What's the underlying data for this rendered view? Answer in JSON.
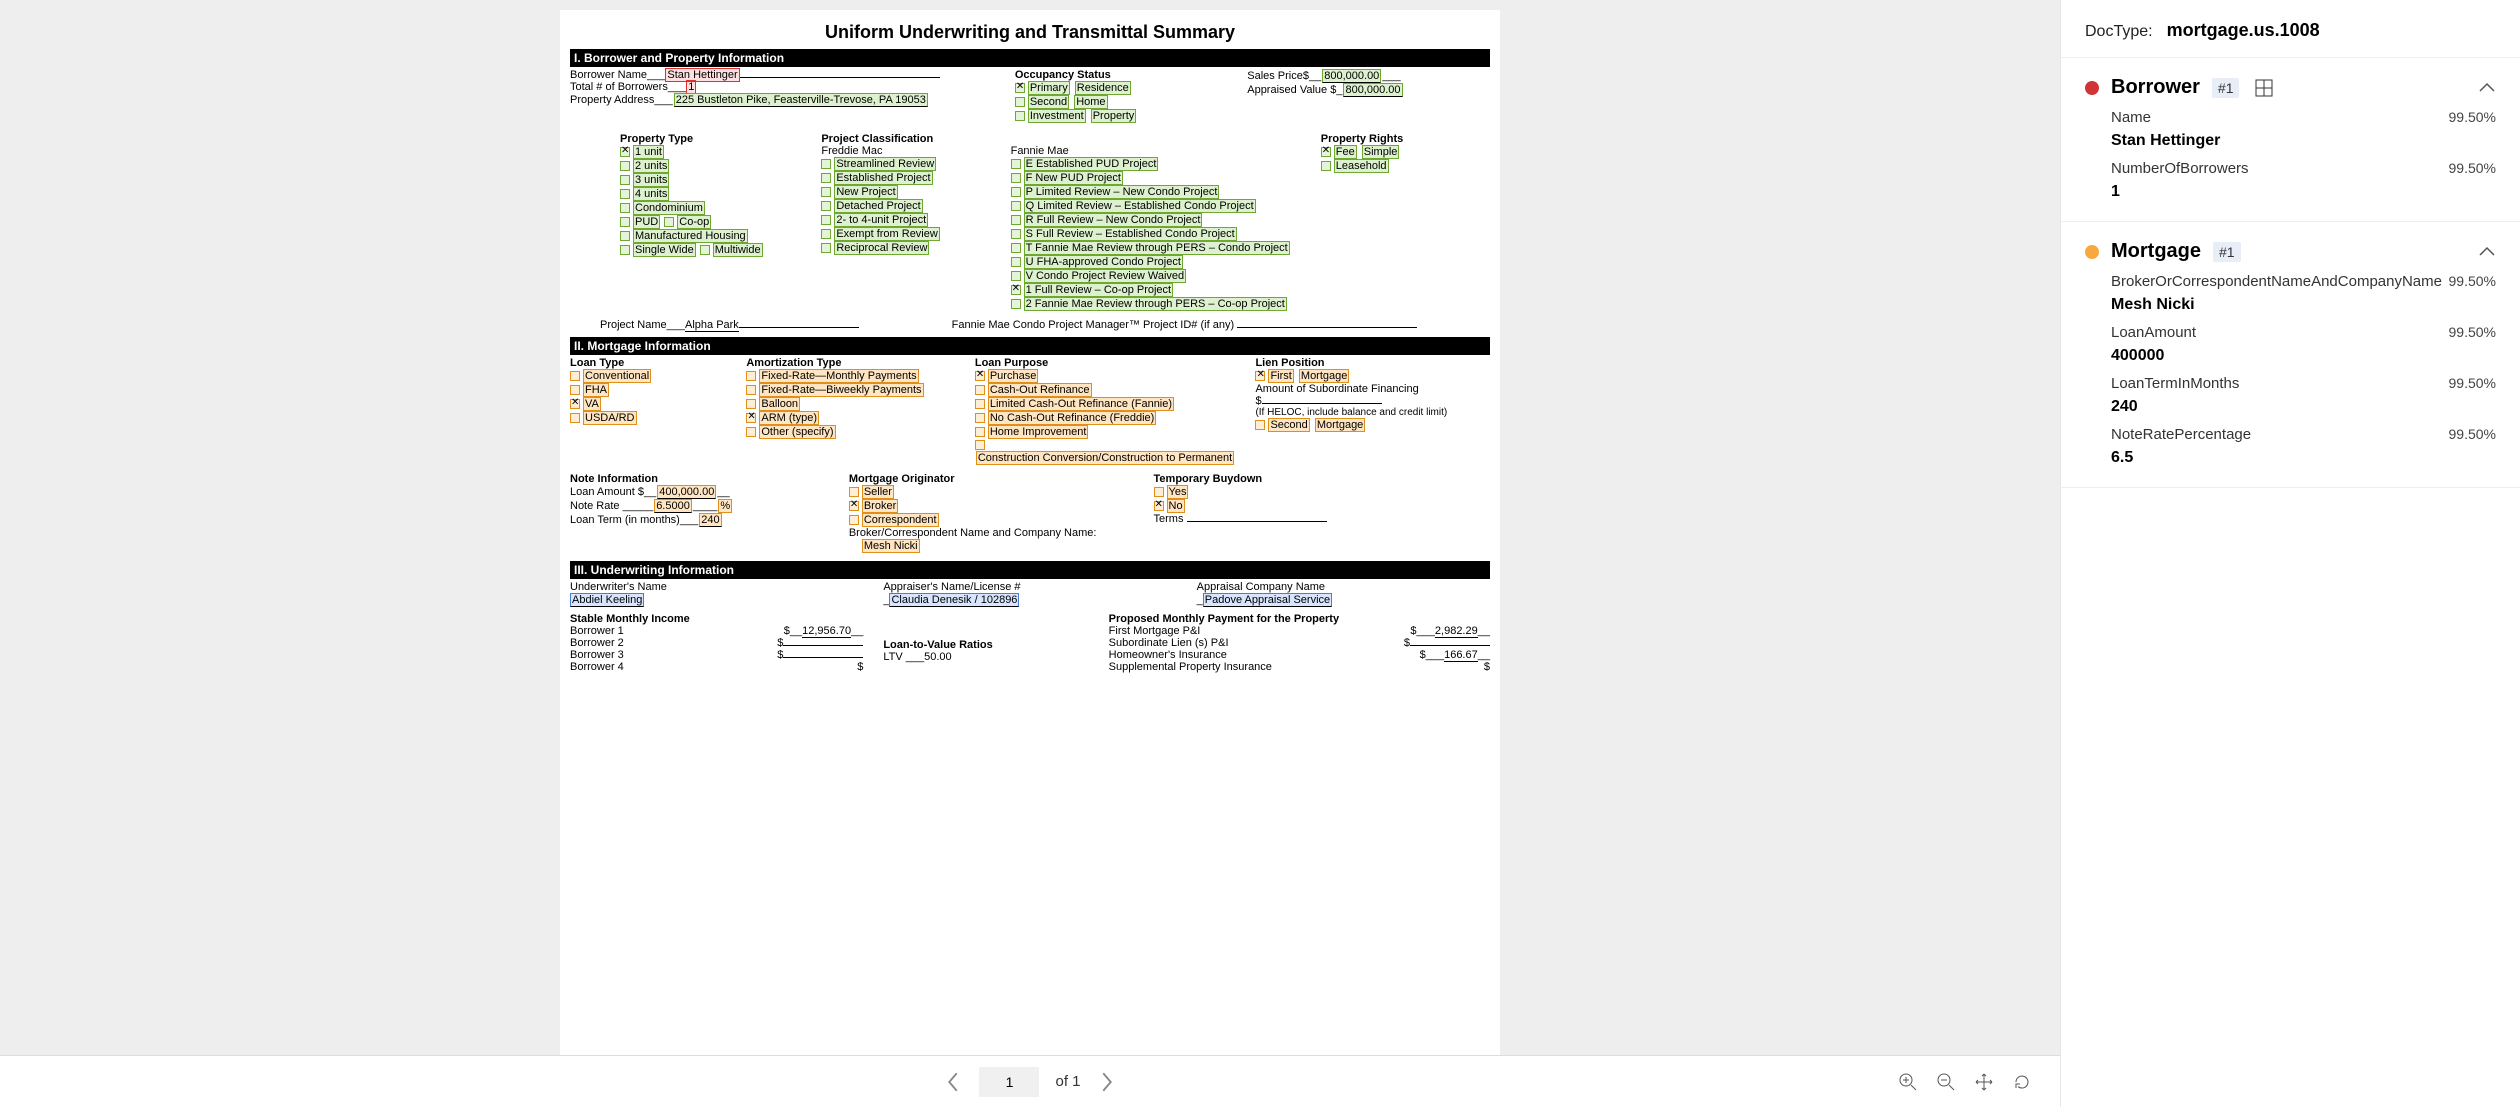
{
  "docTypeLabel": "DocType:",
  "docType": "mortgage.us.1008",
  "title": "Uniform Underwriting and Transmittal Summary",
  "sec1": {
    "header": "I. Borrower and Property Information",
    "borrowerNameLbl": "Borrower Name",
    "borrowerName": "Stan Hettinger",
    "totalBorrowersLbl": "Total # of Borrowers",
    "totalBorrowers": "1",
    "propertyAddressLbl": "Property Address",
    "propertyAddress": "225 Bustleton Pike, Feasterville-Trevose, PA 19053",
    "occupancyLbl": "Occupancy Status",
    "occ1": "Primary",
    "occ1b": "Residence",
    "occ2": "Second",
    "occ2b": "Home",
    "occ3": "Investment",
    "occ3b": "Property",
    "salesPriceLbl": "Sales Price$",
    "salesPrice": "800,000.00",
    "appraisedLbl": "Appraised Value $",
    "appraised": "800,000.00",
    "propTypeLbl": "Property Type",
    "pt": [
      "1 unit",
      "2 units",
      "3 units",
      "4 units",
      "Condominium",
      "PUD",
      "Co-op",
      "Manufactured Housing",
      "Single Wide",
      "Multiwide"
    ],
    "projClassLbl": "Project Classification",
    "freddieLbl": "Freddie Mac",
    "fr": [
      "Streamlined Review",
      "Established Project",
      "New Project",
      "Detached Project",
      "2- to 4-unit Project",
      "Exempt from Review",
      "Reciprocal Review"
    ],
    "fannieLbl": "Fannie Mae",
    "fm": [
      "E Established PUD Project",
      "F New PUD Project",
      "P Limited Review – New Condo Project",
      "Q Limited Review – Established Condo Project",
      "R Full Review – New Condo Project",
      "S Full Review – Established Condo Project",
      "T Fannie Mae Review through PERS – Condo Project",
      "U FHA-approved Condo Project",
      "V Condo Project Review Waived",
      "1 Full Review – Co-op Project",
      "2 Fannie Mae Review through PERS – Co-op Project"
    ],
    "propRightsLbl": "Property Rights",
    "pr1": "Fee",
    "pr1b": "Simple",
    "pr2": "Leasehold",
    "projNameLbl": "Project Name",
    "projName": "Alpha Park",
    "fmcpmLbl": "Fannie Mae Condo Project Manager™ Project ID# (if any)"
  },
  "sec2": {
    "header": "II. Mortgage Information",
    "loanTypeLbl": "Loan Type",
    "lt": [
      "Conventional",
      "FHA",
      "VA",
      "USDA/RD"
    ],
    "amortLbl": "Amortization Type",
    "am": [
      "Fixed-Rate—Monthly Payments",
      "Fixed-Rate—Biweekly Payments",
      "Balloon",
      "ARM (type)",
      "Other (specify)"
    ],
    "loanPurposeLbl": "Loan Purpose",
    "lp": [
      "Purchase",
      "Cash-Out Refinance",
      "Limited Cash-Out Refinance (Fannie)",
      "No Cash-Out Refinance (Freddie)",
      "Home Improvement",
      "Construction Conversion/Construction to Permanent"
    ],
    "lienLbl": "Lien Position",
    "lien1": "First",
    "lien1b": "Mortgage",
    "subFinLbl": "Amount of Subordinate Financing",
    "dollar": "$",
    "helocLbl": "(If HELOC, include balance and credit limit)",
    "lien2": "Second",
    "lien2b": "Mortgage",
    "noteLbl": "Note Information",
    "loanAmtLbl": "Loan Amount $",
    "loanAmt": "400,000.00",
    "noteRateLbl": "Note Rate",
    "noteRate": "6.5000",
    "pct": "%",
    "loanTermLbl": "Loan Term (in months)",
    "loanTerm": "240",
    "mortOrigLbl": "Mortgage Originator",
    "mo": [
      "Seller",
      "Broker",
      "Correspondent"
    ],
    "bcLbl": "Broker/Correspondent Name and Company Name:",
    "bcName": "Mesh Nicki",
    "tempBuyLbl": "Temporary Buydown",
    "tb": [
      "Yes",
      "No"
    ],
    "termsLbl": "Terms"
  },
  "sec3": {
    "header": "III. Underwriting Information",
    "uwNameLbl": "Underwriter's Name",
    "uwName": "Abdiel Keeling",
    "apprNameLbl": "Appraiser's Name/License #",
    "apprName": "Claudia Denesik / 102896",
    "apprCoLbl": "Appraisal Company Name",
    "apprCo": "Padove Appraisal Service",
    "smiLbl": "Stable Monthly Income",
    "b1": "Borrower 1",
    "b2": "Borrower 2",
    "b3": "Borrower 3",
    "b4": "Borrower 4",
    "b1v": "12,956.70",
    "ltvLbl": "Loan-to-Value Ratios",
    "ltv": "LTV",
    "ltvV": "50.00",
    "pmpLbl": "Proposed Monthly Payment for the Property",
    "pmp1": "First Mortgage P&I",
    "pmp1v": "2,982.29",
    "pmp2": "Subordinate Lien (s) P&I",
    "pmp3": "Homeowner's Insurance",
    "pmp3v": "166.67",
    "pmp4": "Supplemental Property Insurance"
  },
  "toolbar": {
    "pageCur": "1",
    "pageOf": "of 1"
  },
  "sidebar": {
    "groups": [
      {
        "color": "red",
        "title": "Borrower",
        "badge": "#1",
        "showGrid": true,
        "fields": [
          {
            "name": "Name",
            "conf": "99.50%",
            "value": "Stan Hettinger"
          },
          {
            "name": "NumberOfBorrowers",
            "conf": "99.50%",
            "value": "1"
          }
        ]
      },
      {
        "color": "orange",
        "title": "Mortgage",
        "badge": "#1",
        "showGrid": false,
        "fields": [
          {
            "name": "BrokerOrCorrespondentNameAndCompanyName",
            "conf": "99.50%",
            "value": "Mesh Nicki"
          },
          {
            "name": "LoanAmount",
            "conf": "99.50%",
            "value": "400000"
          },
          {
            "name": "LoanTermInMonths",
            "conf": "99.50%",
            "value": "240"
          },
          {
            "name": "NoteRatePercentage",
            "conf": "99.50%",
            "value": "6.5"
          }
        ]
      }
    ]
  }
}
